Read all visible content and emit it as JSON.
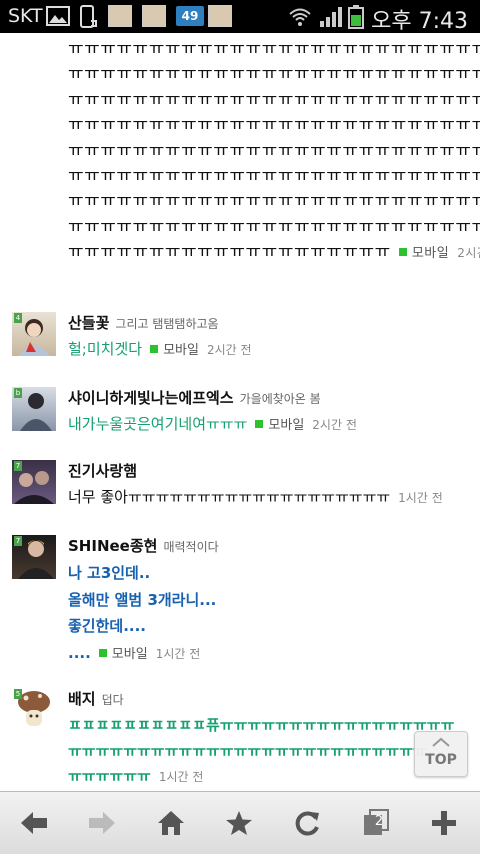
{
  "status_bar": {
    "carrier": "SKT",
    "badge_count": "49",
    "time": "오후 7:43"
  },
  "long_comment": {
    "lines": [
      "ㅠㅠㅠㅠㅠㅠㅠㅠㅠㅠㅠㅠㅠㅠㅠㅠㅠㅠㅠㅠㅠㅠㅠㅠㅠㅠ",
      "ㅠㅠㅠㅠㅠㅠㅠㅠㅠㅠㅠㅠㅠㅠㅠㅠㅠㅠㅠㅠㅠㅠㅠㅠㅠㅠ",
      "ㅠㅠㅠㅠㅠㅠㅠㅠㅠㅠㅠㅠㅠㅠㅠㅠㅠㅠㅠㅠㅠㅠㅠㅠㅠㅠ",
      "ㅠㅠㅠㅠㅠㅠㅠㅠㅠㅠㅠㅠㅠㅠㅠㅠㅠㅠㅠㅠㅠㅠㅠㅠㅠㅠ",
      "ㅠㅠㅠㅠㅠㅠㅠㅠㅠㅠㅠㅠㅠㅠㅠㅠㅠㅠㅠㅠㅠㅠㅠㅠㅠㅠ",
      "ㅠㅠㅠㅠㅠㅠㅠㅠㅠㅠㅠㅠㅠㅠㅠㅠㅠㅠㅠㅠㅠㅠㅠㅠㅠㅠ",
      "ㅠㅠㅠㅠㅠㅠㅠㅠㅠㅠㅠㅠㅠㅠㅠㅠㅠㅠㅠㅠㅠㅠㅠㅠㅠㅠ",
      "ㅠㅠㅠㅠㅠㅠㅠㅠㅠㅠㅠㅠㅠㅠㅠㅠㅠㅠㅠㅠㅠㅠㅠㅠㅠㅠ"
    ],
    "last_line": "ㅠㅠㅠㅠㅠㅠㅠㅠㅠㅠㅠㅠㅠㅠㅠㅠㅠㅠㅠㅠ",
    "source": "모바일",
    "time_ago": "2시간 전"
  },
  "comments": [
    {
      "nick": "산들꽃",
      "status": "그리고 탬탬탬하고옴",
      "text": "헐;미치겟다",
      "source": "모바일",
      "time_ago": "2시간 전",
      "level": "4"
    },
    {
      "nick": "샤이니하게빛나는에프엑스",
      "status": "가을에찾아온 봄",
      "text": "내가누울곳은여기네여ㅠㅠㅠ",
      "source": "모바일",
      "time_ago": "2시간 전",
      "level": "b"
    },
    {
      "nick": "진기사랑햄",
      "status": "",
      "text": "너무 좋아ㅠㅠㅠㅠㅠㅠㅠㅠㅠㅠㅠㅠㅠㅠㅠㅠㅠㅠㅠ",
      "source": "",
      "time_ago": "1시간 전",
      "level": "7"
    },
    {
      "nick": "SHINee종현",
      "status": "매력적이다",
      "text_lines": [
        "나 고3인데..",
        "올해만 앨범 3개라니...",
        "좋긴한데....",
        "...."
      ],
      "source": "모바일",
      "time_ago": "1시간 전",
      "level": "7"
    },
    {
      "nick": "배지",
      "status": "덥다",
      "text_lines": [
        "ㅍㅍㅍㅍㅍㅍㅍㅍㅍㅍ퓨ㅠㅠㅠㅠㅠㅠㅠㅠㅠㅠㅠㅠㅠㅠㅠㅠㅠ",
        "ㅠㅠㅠㅠㅠㅠㅠㅠㅠㅠㅠㅠㅠㅠㅠㅠㅠㅠㅠㅠㅠㅠㅠㅠㅠㅠ",
        "ㅠㅠㅠㅠㅠㅠ"
      ],
      "source": "",
      "time_ago": "1시간 전",
      "level": "5"
    }
  ],
  "top_button": {
    "label": "TOP"
  },
  "toolbar": {
    "tabs_count": "2"
  }
}
